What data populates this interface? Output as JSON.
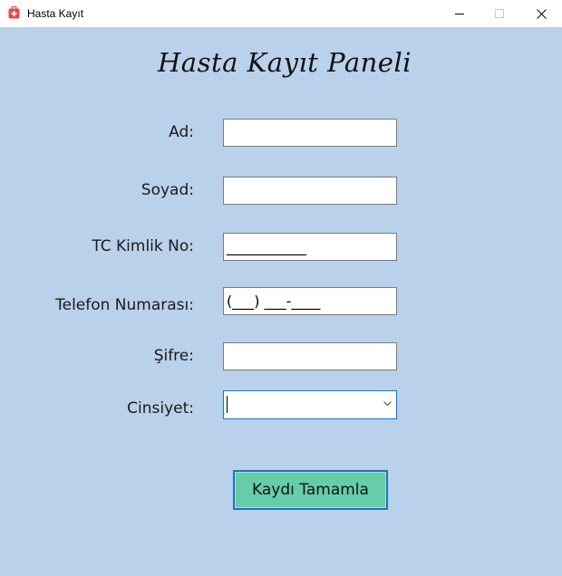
{
  "window": {
    "title": "Hasta Kayıt",
    "minimize_icon": "minimize-icon",
    "maximize_icon": "maximize-icon",
    "close_icon": "close-icon",
    "app_icon": "medical-kit-icon"
  },
  "form": {
    "title": "Hasta Kayıt Paneli",
    "fields": {
      "ad": {
        "label": "Ad:",
        "value": ""
      },
      "soyad": {
        "label": "Soyad:",
        "value": ""
      },
      "tc": {
        "label": "TC Kimlik No:",
        "value": "___________"
      },
      "telefon": {
        "label": "Telefon Numarası:",
        "value": "(___) ___-____"
      },
      "sifre": {
        "label": "Şifre:",
        "value": ""
      },
      "cinsiyet": {
        "label": "Cinsiyet:",
        "value": "",
        "dropdown_icon": "chevron-down-icon"
      }
    },
    "submit_label": "Kaydı Tamamla"
  },
  "colors": {
    "background": "#b9d1ea",
    "button": "#66cdaa",
    "button_border": "#1a73c7",
    "focus_border": "#0078d7"
  }
}
